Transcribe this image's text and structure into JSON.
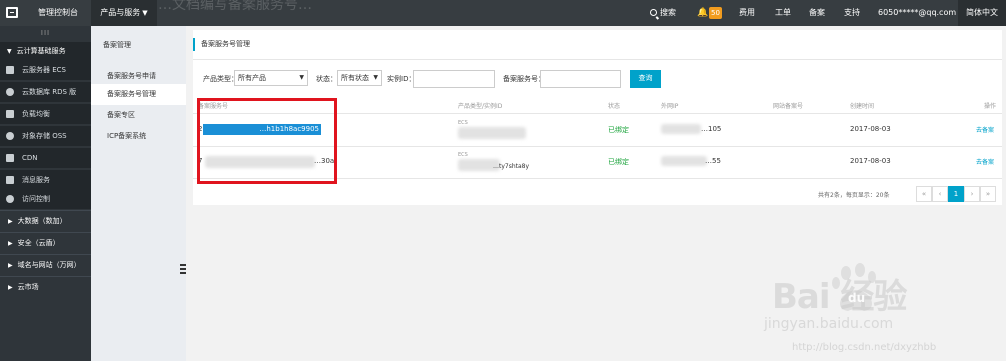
{
  "topbar": {
    "console": "管理控制台",
    "products": "产品与服务",
    "ghost_text": "…文档编写备案服务号…",
    "search": "搜索",
    "badge": "50",
    "fee": "费用",
    "order": "工单",
    "beian": "备案",
    "support": "支持",
    "user": "6050*****@qq.com",
    "lang": "简体中文"
  },
  "sidebar": {
    "collapse": "III",
    "group": "云计算基础服务",
    "items": [
      {
        "label": "云服务器 ECS",
        "icon": "server-icon"
      },
      {
        "label": "云数据库 RDS 版",
        "icon": "database-icon"
      },
      {
        "label": "负载均衡",
        "icon": "load-balance-icon"
      },
      {
        "label": "对象存储 OSS",
        "icon": "storage-icon"
      },
      {
        "label": "CDN",
        "icon": "cdn-icon"
      },
      {
        "label": "消息服务",
        "icon": "message-icon"
      },
      {
        "label": "访问控制",
        "icon": "access-icon"
      }
    ],
    "categories": [
      {
        "label": "大数据（数加）"
      },
      {
        "label": "安全（云盾）"
      },
      {
        "label": "域名与网站（万网）"
      },
      {
        "label": "云市场"
      }
    ]
  },
  "subnav": {
    "title": "备案管理",
    "links": [
      {
        "label": "备案服务号申请"
      },
      {
        "label": "备案服务号管理"
      },
      {
        "label": "备案专区"
      },
      {
        "label": "ICP备案系统"
      }
    ]
  },
  "main": {
    "title": "备案服务号管理",
    "filters": {
      "product_type_label": "产品类型：",
      "product_type_value": "所有产品",
      "status_label": "状态：",
      "status_value": "所有状态",
      "instance_label": "实例ID：",
      "service_no_label": "备案服务号：",
      "query_button": "查询"
    },
    "columns": [
      "备案服务号",
      "产品类型/实例ID",
      "状态",
      "外网IP",
      "网站备案号",
      "创建时间",
      "操作"
    ],
    "rows": [
      {
        "service_no": "…h1b1h8ac9905",
        "prefix": "2",
        "product": "ECS",
        "instance": "",
        "status": "已绑定",
        "ip": "…105",
        "icp": "",
        "created": "2017-08-03",
        "action": "去备案"
      },
      {
        "service_no": "…30a",
        "prefix": "7",
        "product": "ECS",
        "instance": "…ty7shta8y",
        "status": "已绑定",
        "ip": "…55",
        "icp": "",
        "created": "2017-08-03",
        "action": "去备案"
      }
    ],
    "pager": {
      "info": "共有2条，每页显示：20条",
      "first": "«",
      "prev": "‹",
      "current": "1",
      "next": "›",
      "last": "»"
    }
  },
  "watermark": {
    "brand": "Bai 经验",
    "du": "du",
    "sub": "jingyan.baidu.com",
    "url": "http://blog.csdn.net/dxyzhbb"
  }
}
